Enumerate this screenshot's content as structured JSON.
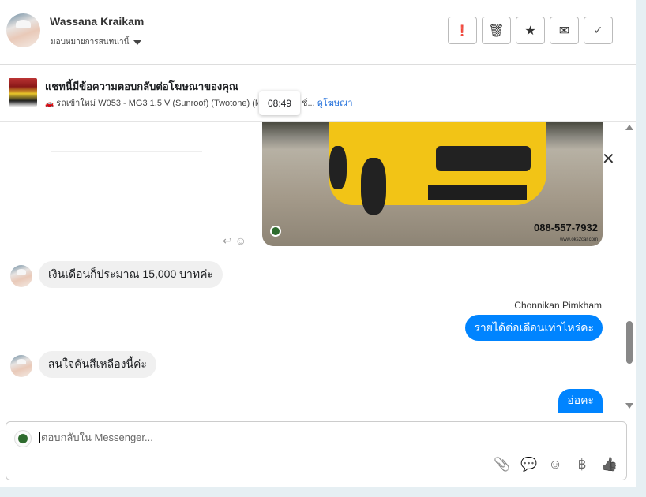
{
  "header": {
    "contact_name": "Wassana Kraikam",
    "assign_label": "มอบหมายการสนทนานี้",
    "actions": [
      {
        "name": "spam",
        "icon": "exclamation-icon",
        "glyph": "❗"
      },
      {
        "name": "delete",
        "icon": "trash-icon",
        "glyph": "🗑"
      },
      {
        "name": "star",
        "icon": "star-icon",
        "glyph": "★"
      },
      {
        "name": "mark-unread",
        "icon": "envelope-icon",
        "glyph": "✉"
      },
      {
        "name": "done",
        "icon": "check-icon",
        "glyph": "✓"
      }
    ]
  },
  "ad_banner": {
    "title": "แชทนี้มีข้อความตอบกลับต่อโฆษณาของคุณ",
    "car_emoji": "🚗",
    "subtitle": "รถเข้าใหม่ W053 - MG3 1.5 V (Sunroof) (Twotone) (MN",
    "subtitle_tail": "ช์...",
    "link": "ดูโฆษณา",
    "tooltip": "08:49"
  },
  "image": {
    "phone": "088-557-7932",
    "website": "www.oks2car.com"
  },
  "messages": [
    {
      "dir": "in",
      "text": "เงินเดือนก็ประมาณ 15,000 บาทค่ะ"
    },
    {
      "dir": "out",
      "sender": "Chonnikan Pimkham",
      "text": "รายได้ต่อเดือนเท่าไหร่คะ"
    },
    {
      "dir": "in",
      "text": "สนใจคันสีเหลืองนี้ค่ะ"
    },
    {
      "dir": "out",
      "text": "อ่อคะ"
    }
  ],
  "composer": {
    "placeholder": "ตอบกลับใน Messenger...",
    "tools": [
      "📎",
      "💬",
      "☺",
      "฿",
      "👍"
    ]
  },
  "colors": {
    "accent": "#0084ff",
    "link": "#216fdb"
  }
}
